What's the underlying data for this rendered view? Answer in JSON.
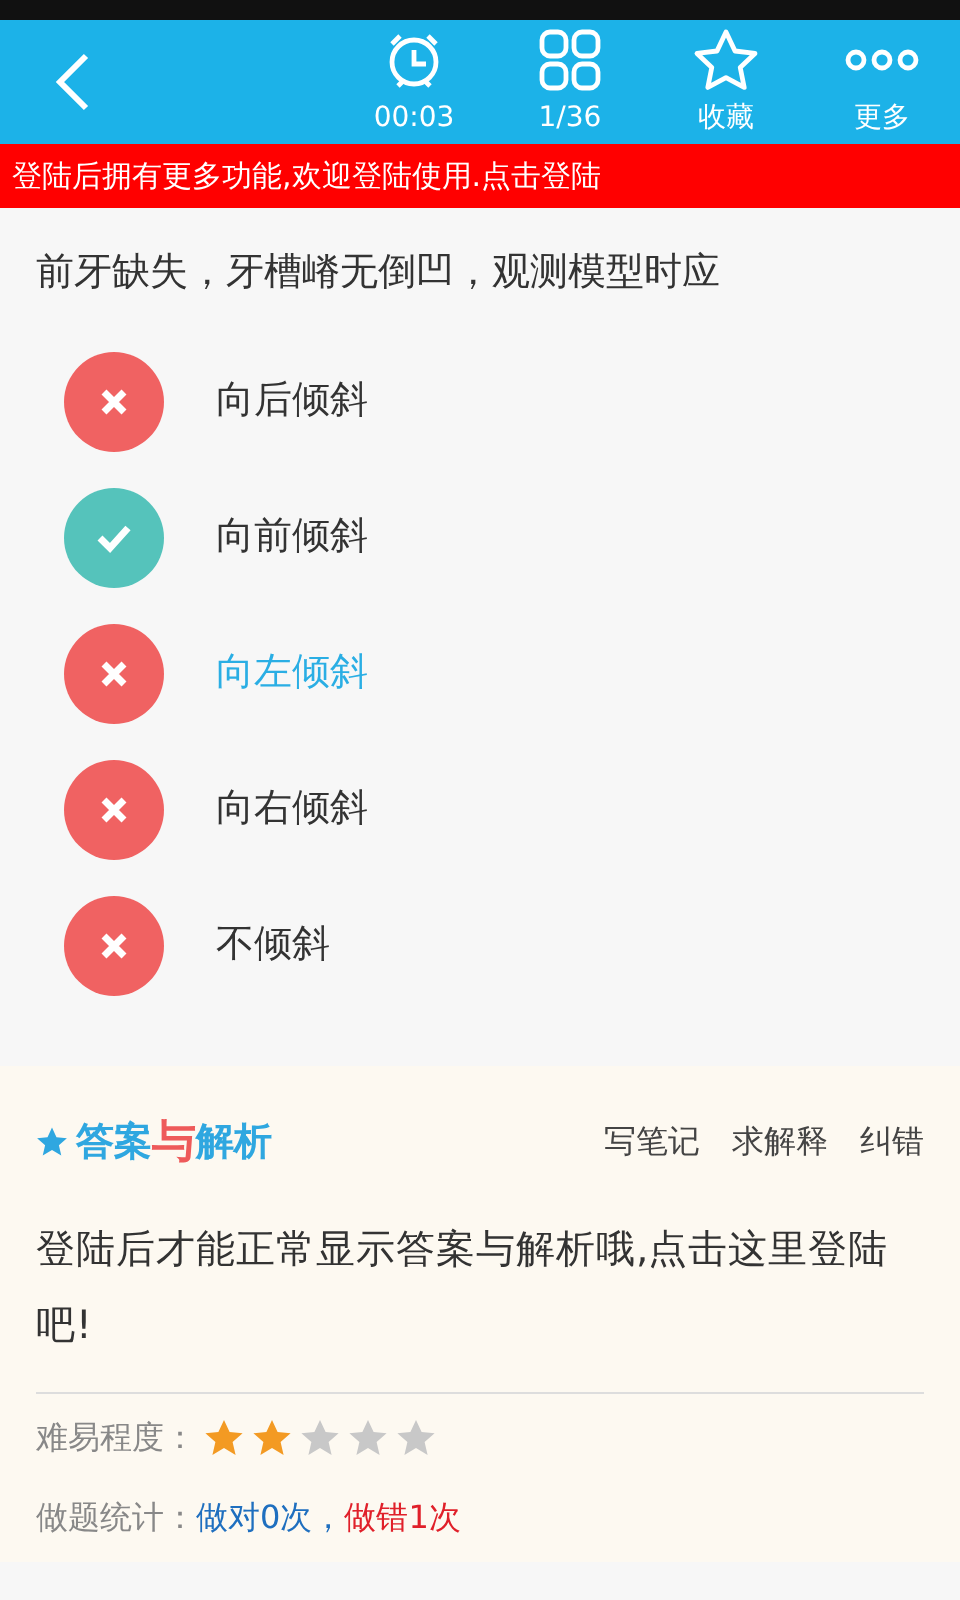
{
  "toolbar": {
    "items": [
      {
        "kind": "clock",
        "label": "00:03"
      },
      {
        "kind": "grid",
        "label": "1/36"
      },
      {
        "kind": "star",
        "label": "收藏"
      },
      {
        "kind": "more",
        "label": "更多"
      }
    ]
  },
  "login_banner": "登陆后拥有更多功能,欢迎登陆使用.点击登陆",
  "question": "前牙缺失，牙槽嵴无倒凹，观测模型时应",
  "options": [
    {
      "text": "向后倾斜",
      "correct": false,
      "selected": false
    },
    {
      "text": "向前倾斜",
      "correct": true,
      "selected": false
    },
    {
      "text": "向左倾斜",
      "correct": false,
      "selected": true
    },
    {
      "text": "向右倾斜",
      "correct": false,
      "selected": false
    },
    {
      "text": "不倾斜",
      "correct": false,
      "selected": false
    }
  ],
  "analysis": {
    "title": [
      {
        "text": "答案",
        "accent": false
      },
      {
        "text": "与",
        "accent": true
      },
      {
        "text": "解析",
        "accent": false
      }
    ],
    "actions": [
      "写笔记",
      "求解释",
      "纠错"
    ],
    "message": "登陆后才能正常显示答案与解析哦,点击这里登陆吧!",
    "difficulty": {
      "label": "难易程度：",
      "stars": 2
    },
    "stats": {
      "label": "做题统计：",
      "items": [
        {
          "text": "做对0次",
          "color": "#1f6fbf"
        },
        {
          "text": "，",
          "color": "#1f6fbf"
        },
        {
          "text": "做错1次",
          "color": "#e0202a"
        }
      ]
    }
  }
}
